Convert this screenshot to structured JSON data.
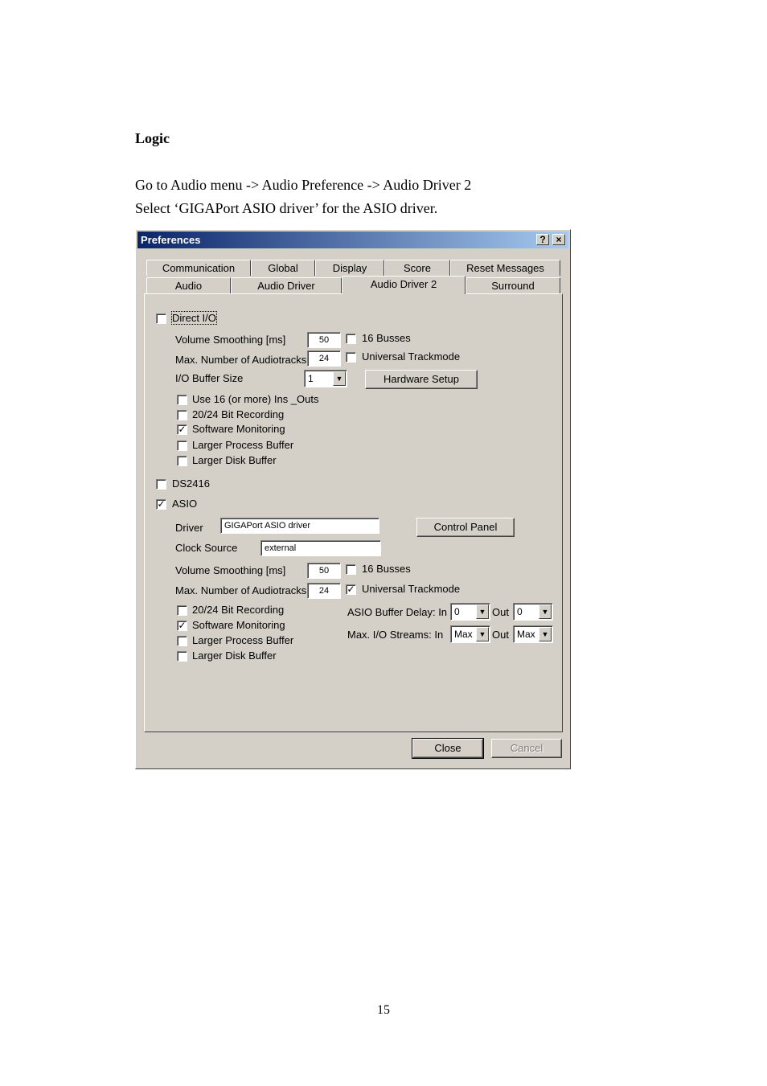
{
  "document": {
    "heading": "Logic",
    "line1": "Go to Audio menu -> Audio Preference -> Audio Driver 2",
    "line2": "Select ‘GIGAPort ASIO driver’ for the ASIO driver.",
    "page_number": "15"
  },
  "dialog": {
    "title": "Preferences",
    "help_glyph": "?",
    "close_glyph": "×",
    "tabs_row1": [
      "Communication",
      "Global",
      "Display",
      "Score",
      "Reset Messages"
    ],
    "tabs_row2": [
      "Audio",
      "Audio Driver",
      "Audio Driver 2",
      "Surround"
    ],
    "active_tab": "Audio Driver 2",
    "direct_io": {
      "label": "Direct I/O",
      "checked": false,
      "volume_smoothing_label": "Volume Smoothing [ms]",
      "volume_smoothing_value": "50",
      "max_audiotracks_label": "Max. Number of Audiotracks",
      "max_audiotracks_value": "24",
      "busses_label": "16 Busses",
      "universal_trackmode_label": "Universal Trackmode",
      "io_buffer_label": "I/O Buffer Size",
      "io_buffer_value": "1",
      "hardware_setup_label": "Hardware Setup",
      "options": [
        {
          "label": "Use 16 (or more) Ins _Outs",
          "checked": false
        },
        {
          "label": "20/24 Bit Recording",
          "checked": false
        },
        {
          "label": "Software Monitoring",
          "checked": true
        },
        {
          "label": "Larger Process Buffer",
          "checked": false
        },
        {
          "label": "Larger Disk Buffer",
          "checked": false
        }
      ]
    },
    "ds2416": {
      "label": "DS2416",
      "checked": false
    },
    "asio": {
      "label": "ASIO",
      "checked": true,
      "driver_label": "Driver",
      "driver_value": "GIGAPort ASIO driver",
      "control_panel_label": "Control Panel",
      "clock_source_label": "Clock Source",
      "clock_source_value": "external",
      "volume_smoothing_label": "Volume Smoothing [ms]",
      "volume_smoothing_value": "50",
      "max_audiotracks_label": "Max. Number of Audiotracks",
      "max_audiotracks_value": "24",
      "busses_label": "16 Busses",
      "busses_checked": false,
      "universal_trackmode_label": "Universal Trackmode",
      "universal_trackmode_checked": true,
      "buffer_delay_label": "ASIO Buffer Delay:  In",
      "buffer_delay_in": "0",
      "buffer_delay_out_label": "Out",
      "buffer_delay_out": "0",
      "io_streams_label": "Max. I/O Streams:  In",
      "io_streams_in": "Max",
      "io_streams_out_label": "Out",
      "io_streams_out": "Max",
      "options": [
        {
          "label": "20/24 Bit Recording",
          "checked": false
        },
        {
          "label": "Software Monitoring",
          "checked": true
        },
        {
          "label": "Larger Process Buffer",
          "checked": false
        },
        {
          "label": "Larger Disk Buffer",
          "checked": false
        }
      ]
    },
    "close_button": "Close",
    "cancel_button": "Cancel",
    "check_glyph": "✓",
    "dropdown_glyph": "▼"
  }
}
